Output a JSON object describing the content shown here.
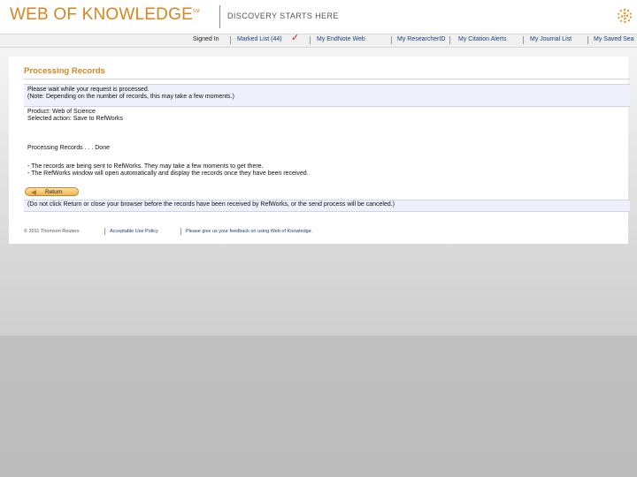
{
  "header": {
    "logo_text": "WEB OF KNOWLEDGE",
    "logo_tm": "SM",
    "tagline": "DISCOVERY STARTS HERE",
    "globe_icon": "thomson-reuters-globe-icon"
  },
  "nav": {
    "signed_in": "Signed In",
    "marked_list": "Marked List (44)",
    "endnote": "My EndNote Web",
    "researcherid": "My ResearcherID",
    "citation_alerts": "My Citation Alerts",
    "journal_list": "My Journal List",
    "saved_searches": "My Saved Sea"
  },
  "main": {
    "title": "Processing Records",
    "wait_line1": "Please wait while your request is processed.",
    "wait_line2": "(Note: Depending on the number of records, this may take a few moments.)",
    "product": "Product: Web of Science",
    "action": "Selected action: Save to RefWorks",
    "processing": "Processing Records . . . Done",
    "info1": "- The records are being sent to RefWorks. They may take a few moments to get there.",
    "info2": "- The RefWorks window will open automatically and display the records once they have been received.",
    "return_label": "Return",
    "warning": "(Do not click Return or close your browser before the records have been received by RefWorks, or the send process will be canceled.)"
  },
  "footer": {
    "copyright": "© 2011 Thomson Reuters",
    "privacy": "Acceptable Use Policy",
    "feedback": "Please give us your feedback on using Web of Knowledge."
  },
  "colors": {
    "brand_orange": "#d6861f",
    "link_blue": "#1a3d7c",
    "message_bg": "#eef0fb"
  }
}
